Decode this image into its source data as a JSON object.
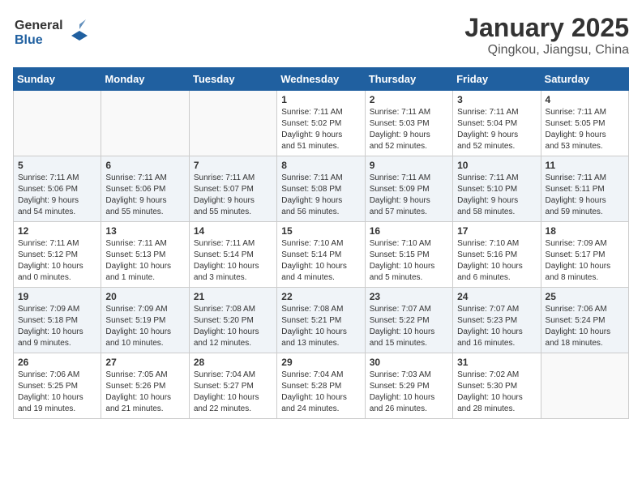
{
  "header": {
    "logo_general": "General",
    "logo_blue": "Blue",
    "title": "January 2025",
    "subtitle": "Qingkou, Jiangsu, China"
  },
  "weekdays": [
    "Sunday",
    "Monday",
    "Tuesday",
    "Wednesday",
    "Thursday",
    "Friday",
    "Saturday"
  ],
  "weeks": [
    [
      {
        "day": "",
        "info": ""
      },
      {
        "day": "",
        "info": ""
      },
      {
        "day": "",
        "info": ""
      },
      {
        "day": "1",
        "info": "Sunrise: 7:11 AM\nSunset: 5:02 PM\nDaylight: 9 hours\nand 51 minutes."
      },
      {
        "day": "2",
        "info": "Sunrise: 7:11 AM\nSunset: 5:03 PM\nDaylight: 9 hours\nand 52 minutes."
      },
      {
        "day": "3",
        "info": "Sunrise: 7:11 AM\nSunset: 5:04 PM\nDaylight: 9 hours\nand 52 minutes."
      },
      {
        "day": "4",
        "info": "Sunrise: 7:11 AM\nSunset: 5:05 PM\nDaylight: 9 hours\nand 53 minutes."
      }
    ],
    [
      {
        "day": "5",
        "info": "Sunrise: 7:11 AM\nSunset: 5:06 PM\nDaylight: 9 hours\nand 54 minutes."
      },
      {
        "day": "6",
        "info": "Sunrise: 7:11 AM\nSunset: 5:06 PM\nDaylight: 9 hours\nand 55 minutes."
      },
      {
        "day": "7",
        "info": "Sunrise: 7:11 AM\nSunset: 5:07 PM\nDaylight: 9 hours\nand 55 minutes."
      },
      {
        "day": "8",
        "info": "Sunrise: 7:11 AM\nSunset: 5:08 PM\nDaylight: 9 hours\nand 56 minutes."
      },
      {
        "day": "9",
        "info": "Sunrise: 7:11 AM\nSunset: 5:09 PM\nDaylight: 9 hours\nand 57 minutes."
      },
      {
        "day": "10",
        "info": "Sunrise: 7:11 AM\nSunset: 5:10 PM\nDaylight: 9 hours\nand 58 minutes."
      },
      {
        "day": "11",
        "info": "Sunrise: 7:11 AM\nSunset: 5:11 PM\nDaylight: 9 hours\nand 59 minutes."
      }
    ],
    [
      {
        "day": "12",
        "info": "Sunrise: 7:11 AM\nSunset: 5:12 PM\nDaylight: 10 hours\nand 0 minutes."
      },
      {
        "day": "13",
        "info": "Sunrise: 7:11 AM\nSunset: 5:13 PM\nDaylight: 10 hours\nand 1 minute."
      },
      {
        "day": "14",
        "info": "Sunrise: 7:11 AM\nSunset: 5:14 PM\nDaylight: 10 hours\nand 3 minutes."
      },
      {
        "day": "15",
        "info": "Sunrise: 7:10 AM\nSunset: 5:14 PM\nDaylight: 10 hours\nand 4 minutes."
      },
      {
        "day": "16",
        "info": "Sunrise: 7:10 AM\nSunset: 5:15 PM\nDaylight: 10 hours\nand 5 minutes."
      },
      {
        "day": "17",
        "info": "Sunrise: 7:10 AM\nSunset: 5:16 PM\nDaylight: 10 hours\nand 6 minutes."
      },
      {
        "day": "18",
        "info": "Sunrise: 7:09 AM\nSunset: 5:17 PM\nDaylight: 10 hours\nand 8 minutes."
      }
    ],
    [
      {
        "day": "19",
        "info": "Sunrise: 7:09 AM\nSunset: 5:18 PM\nDaylight: 10 hours\nand 9 minutes."
      },
      {
        "day": "20",
        "info": "Sunrise: 7:09 AM\nSunset: 5:19 PM\nDaylight: 10 hours\nand 10 minutes."
      },
      {
        "day": "21",
        "info": "Sunrise: 7:08 AM\nSunset: 5:20 PM\nDaylight: 10 hours\nand 12 minutes."
      },
      {
        "day": "22",
        "info": "Sunrise: 7:08 AM\nSunset: 5:21 PM\nDaylight: 10 hours\nand 13 minutes."
      },
      {
        "day": "23",
        "info": "Sunrise: 7:07 AM\nSunset: 5:22 PM\nDaylight: 10 hours\nand 15 minutes."
      },
      {
        "day": "24",
        "info": "Sunrise: 7:07 AM\nSunset: 5:23 PM\nDaylight: 10 hours\nand 16 minutes."
      },
      {
        "day": "25",
        "info": "Sunrise: 7:06 AM\nSunset: 5:24 PM\nDaylight: 10 hours\nand 18 minutes."
      }
    ],
    [
      {
        "day": "26",
        "info": "Sunrise: 7:06 AM\nSunset: 5:25 PM\nDaylight: 10 hours\nand 19 minutes."
      },
      {
        "day": "27",
        "info": "Sunrise: 7:05 AM\nSunset: 5:26 PM\nDaylight: 10 hours\nand 21 minutes."
      },
      {
        "day": "28",
        "info": "Sunrise: 7:04 AM\nSunset: 5:27 PM\nDaylight: 10 hours\nand 22 minutes."
      },
      {
        "day": "29",
        "info": "Sunrise: 7:04 AM\nSunset: 5:28 PM\nDaylight: 10 hours\nand 24 minutes."
      },
      {
        "day": "30",
        "info": "Sunrise: 7:03 AM\nSunset: 5:29 PM\nDaylight: 10 hours\nand 26 minutes."
      },
      {
        "day": "31",
        "info": "Sunrise: 7:02 AM\nSunset: 5:30 PM\nDaylight: 10 hours\nand 28 minutes."
      },
      {
        "day": "",
        "info": ""
      }
    ]
  ]
}
